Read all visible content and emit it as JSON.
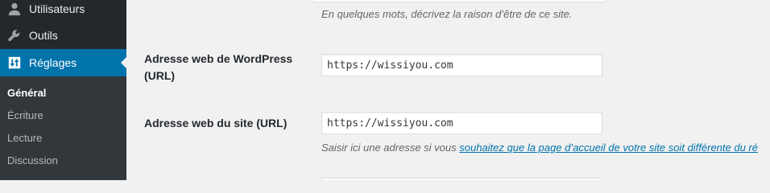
{
  "sidebar": {
    "menu": [
      {
        "label": "Utilisateurs",
        "icon": "users-icon"
      },
      {
        "label": "Outils",
        "icon": "wrench-icon"
      },
      {
        "label": "Réglages",
        "icon": "settings-sliders-icon",
        "active": true
      }
    ],
    "submenu": [
      {
        "label": "Général",
        "current": true
      },
      {
        "label": "Écriture"
      },
      {
        "label": "Lecture"
      },
      {
        "label": "Discussion"
      }
    ]
  },
  "form": {
    "tagline_description": "En quelques mots, décrivez la raison d’être de ce site.",
    "wordpress_url": {
      "label": "Adresse web de WordPress (URL)",
      "value": "https://wissiyou.com"
    },
    "site_url": {
      "label": "Adresse web du site (URL)",
      "value": "https://wissiyou.com",
      "description_prefix": "Saisir ici une adresse si vous ",
      "description_link": "souhaitez que la page d’accueil de votre site soit différente du ré"
    }
  },
  "colors": {
    "sidebar_bg": "#23282d",
    "submenu_bg": "#32373c",
    "active_bg": "#0073aa",
    "link": "#0073aa",
    "content_bg": "#f1f1f1"
  }
}
